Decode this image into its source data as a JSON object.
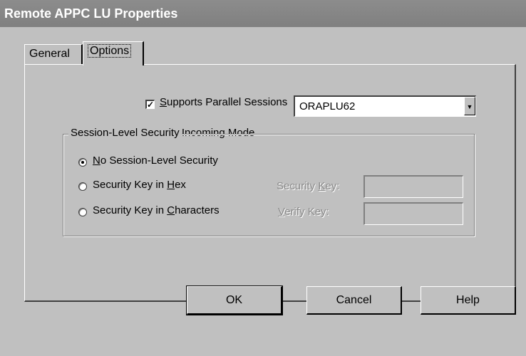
{
  "window": {
    "title": "Remote APPC LU Properties"
  },
  "tabs": [
    {
      "label": "General",
      "active": false
    },
    {
      "label": "Options",
      "active": true
    }
  ],
  "options": {
    "parallel_sessions": {
      "prefix": "",
      "accel": "S",
      "rest": "upports Parallel Sessions",
      "checked": true
    },
    "implicit_mode": {
      "accel": "I",
      "rest": "mplicit Incoming Mode",
      "value": "ORAPLU62"
    }
  },
  "security_group": {
    "title": "Session-Level Security",
    "radios": [
      {
        "accel": "N",
        "rest": "o Session-Level Security",
        "pre": "",
        "selected": true
      },
      {
        "pre": "Security Key in ",
        "accel": "H",
        "rest": "ex",
        "selected": false
      },
      {
        "pre": "Security Key in ",
        "accel": "C",
        "rest": "haracters",
        "selected": false
      }
    ],
    "security_key": {
      "pre": "Security ",
      "accel": "K",
      "rest": "ey:",
      "value": ""
    },
    "verify_key": {
      "pre": "",
      "accel": "V",
      "rest": "erify Key:",
      "value": ""
    }
  },
  "buttons": {
    "ok": "OK",
    "cancel": "Cancel",
    "help": "Help"
  },
  "colors": {
    "titlebar": "#808080",
    "face": "#c0c0c0",
    "disabled_text": "#8a8a8a"
  }
}
